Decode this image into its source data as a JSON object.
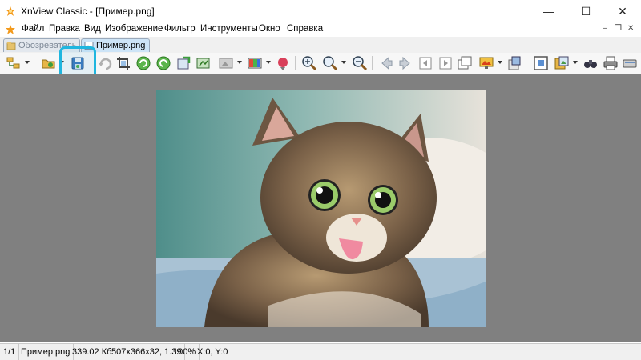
{
  "window": {
    "title": "XnView Classic - [Пример.png]",
    "minimize_glyph": "—",
    "maximize_glyph": "☐",
    "close_glyph": "✕"
  },
  "menu": {
    "items": [
      "Файл",
      "Правка",
      "Вид",
      "Изображение",
      "Фильтр",
      "Инструменты",
      "Окно",
      "Справка"
    ],
    "mdi_minimize": "‒",
    "mdi_restore": "❐",
    "mdi_close": "✕"
  },
  "tabs": [
    {
      "label": "Обозреватель",
      "active": false
    },
    {
      "label": "Пример.png",
      "active": true
    }
  ],
  "toolbar": {
    "icons": [
      "browser-tree-icon",
      "open-folder-icon",
      "save-icon",
      "undo-icon",
      "crop-icon",
      "rotate-left-icon",
      "rotate-right-icon",
      "export-icon",
      "convert-icon",
      "slideshow-icon",
      "color-adjust-icon",
      "filter-icon",
      "zoom-in-icon",
      "zoom-fit-icon",
      "zoom-out-icon",
      "previous-icon",
      "next-icon",
      "first-page-icon",
      "last-page-icon",
      "fullscreen-window-icon",
      "screen-icon",
      "properties-icon",
      "fit-window-icon",
      "copy-image-icon",
      "find-icon",
      "print-icon",
      "scan-icon"
    ],
    "highlighted": "save-icon"
  },
  "accent_color": "#1fb6df",
  "viewer_background": "#808080",
  "image": {
    "description_icon": "cat-photo-image"
  },
  "status": {
    "index": "1/1",
    "filename": "Пример.png",
    "filesize": "339.02 Кб",
    "dimensions": "507x366x32, 1.39",
    "zoom": "100%",
    "coords": "X:0, Y:0"
  }
}
